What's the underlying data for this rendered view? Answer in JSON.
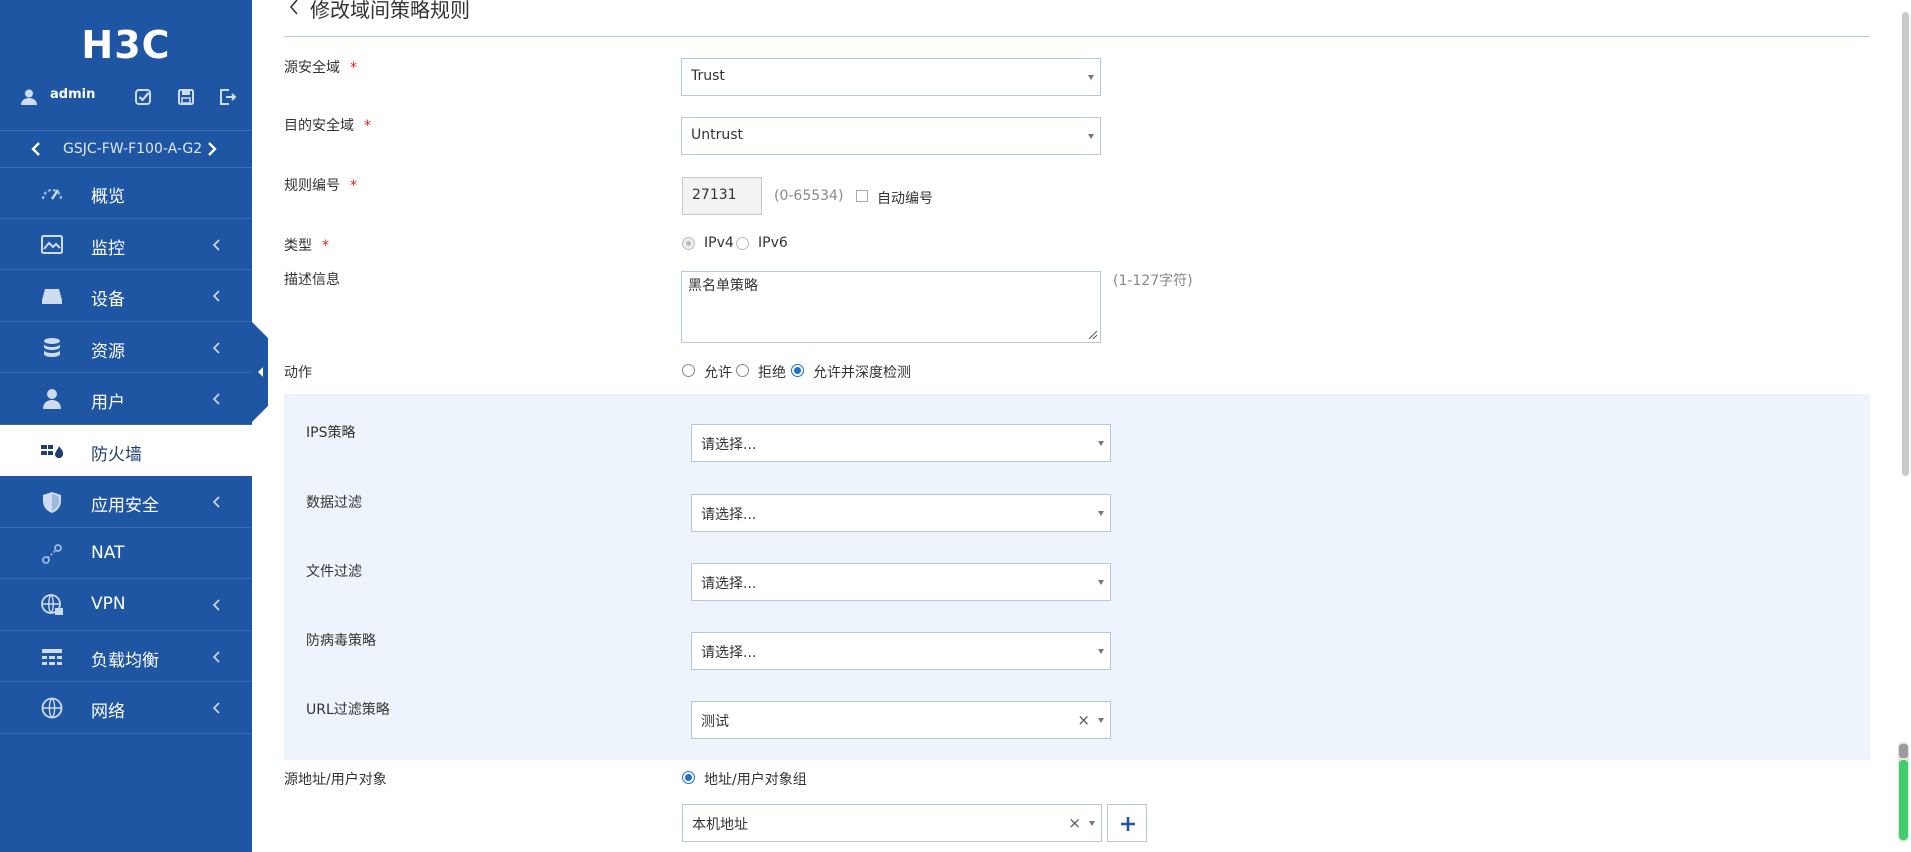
{
  "brand": {
    "logo_text": "H3C"
  },
  "user": {
    "name": "admin"
  },
  "device": {
    "name": "GSJC-FW-F100-A-G2"
  },
  "menu": [
    {
      "label": "概览",
      "icon": "dashboard-icon",
      "has_arrow": false,
      "active": false
    },
    {
      "label": "监控",
      "icon": "monitor-icon",
      "has_arrow": true,
      "active": false
    },
    {
      "label": "设备",
      "icon": "device-icon",
      "has_arrow": true,
      "active": false
    },
    {
      "label": "资源",
      "icon": "database-icon",
      "has_arrow": true,
      "active": false
    },
    {
      "label": "用户",
      "icon": "user-icon",
      "has_arrow": true,
      "active": false
    },
    {
      "label": "防火墙",
      "icon": "firewall-icon",
      "has_arrow": false,
      "active": true
    },
    {
      "label": "应用安全",
      "icon": "shield-icon",
      "has_arrow": true,
      "active": false
    },
    {
      "label": "NAT",
      "icon": "nat-icon",
      "has_arrow": false,
      "active": false
    },
    {
      "label": "VPN",
      "icon": "globe-lock-icon",
      "has_arrow": true,
      "active": false
    },
    {
      "label": "负载均衡",
      "icon": "load-balance-icon",
      "has_arrow": true,
      "active": false
    },
    {
      "label": "网络",
      "icon": "globe-icon",
      "has_arrow": true,
      "active": false
    }
  ],
  "page": {
    "title": "修改域间策略规则"
  },
  "form": {
    "src_zone": {
      "label": "源安全域",
      "required_mark": "*",
      "value": "Trust"
    },
    "dst_zone": {
      "label": "目的安全域",
      "required_mark": "*",
      "value": "Untrust"
    },
    "rule_id": {
      "label": "规则编号",
      "required_mark": "*",
      "value": "27131",
      "hint": "(0-65534)",
      "auto_label": "自动编号"
    },
    "type": {
      "label": "类型",
      "required_mark": "*",
      "options": [
        "IPv4",
        "IPv6"
      ],
      "selected": "IPv4"
    },
    "description": {
      "label": "描述信息",
      "value": "黑名单策略",
      "hint": "(1-127字符)"
    },
    "action": {
      "label": "动作",
      "options": [
        "允许",
        "拒绝",
        "允许并深度检测"
      ],
      "selected": "允许并深度检测"
    },
    "ips": {
      "label": "IPS策略",
      "placeholder": "请选择..."
    },
    "data_filter": {
      "label": "数据过滤",
      "placeholder": "请选择..."
    },
    "file_filter": {
      "label": "文件过滤",
      "placeholder": "请选择..."
    },
    "antivirus": {
      "label": "防病毒策略",
      "placeholder": "请选择..."
    },
    "url_filter": {
      "label": "URL过滤策略",
      "value": "测试"
    },
    "src_addr": {
      "label": "源地址/用户对象",
      "mode_label": "地址/用户对象组",
      "value": "本机地址"
    }
  },
  "colors": {
    "sidebar": "#1f56a3",
    "panel": "#eef4fb",
    "accent": "#1f6fd1",
    "required": "#e02020"
  }
}
